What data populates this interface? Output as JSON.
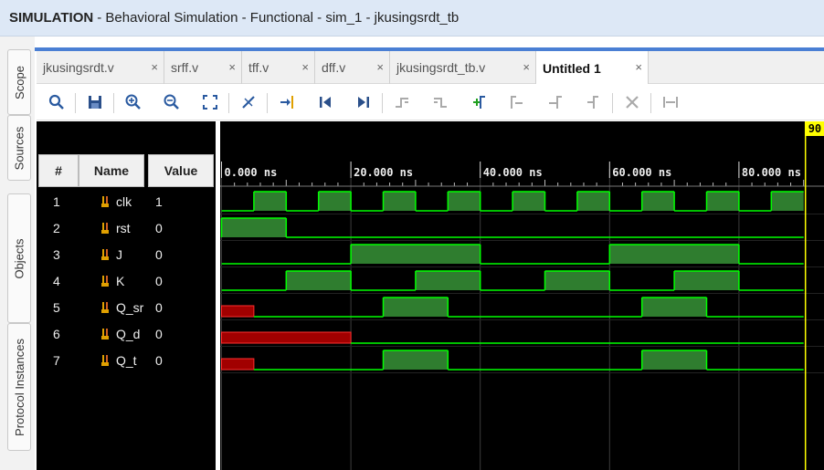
{
  "title": {
    "bold": "SIMULATION",
    "rest": "- Behavioral Simulation - Functional - sim_1 - jkusingsrdt_tb"
  },
  "side_tabs": [
    "Scope",
    "Sources",
    "Objects",
    "Protocol Instances"
  ],
  "tabs": [
    {
      "label": "jkusingsrdt.v",
      "close": "×"
    },
    {
      "label": "srff.v",
      "close": "×"
    },
    {
      "label": "tff.v",
      "close": "×"
    },
    {
      "label": "dff.v",
      "close": "×"
    },
    {
      "label": "jkusingsrdt_tb.v",
      "close": "×"
    },
    {
      "label": "Untitled 1",
      "close": "×"
    }
  ],
  "toolbar": [
    "search-icon",
    "save-icon",
    "zoom-in-icon",
    "zoom-out-icon",
    "zoom-fit-icon",
    "cursor-snap-icon",
    "go-to-cursor-icon",
    "go-to-start-icon",
    "go-to-end-icon",
    "previous-transition-icon",
    "next-transition-icon",
    "add-marker-icon",
    "previous-marker-icon",
    "next-marker-icon",
    "swap-cursors-icon",
    "delete-marker-icon",
    "marker-range-icon"
  ],
  "columns": {
    "num": "#",
    "name": "Name",
    "value": "Value"
  },
  "signals": [
    {
      "num": "1",
      "name": "clk",
      "value": "1"
    },
    {
      "num": "2",
      "name": "rst",
      "value": "0"
    },
    {
      "num": "3",
      "name": "J",
      "value": "0"
    },
    {
      "num": "4",
      "name": "K",
      "value": "0"
    },
    {
      "num": "5",
      "name": "Q_sr",
      "value": "0"
    },
    {
      "num": "6",
      "name": "Q_d",
      "value": "0"
    },
    {
      "num": "7",
      "name": "Q_t",
      "value": "0"
    }
  ],
  "timeline": {
    "ticks": [
      {
        "t": 0,
        "label": "0.000 ns"
      },
      {
        "t": 20,
        "label": "20.000 ns"
      },
      {
        "t": 40,
        "label": "40.000 ns"
      },
      {
        "t": 60,
        "label": "60.000 ns"
      },
      {
        "t": 80,
        "label": "80.000 ns"
      }
    ],
    "cursor_time": 90,
    "cursor_label": "90",
    "view_range_ns": [
      0,
      90
    ]
  },
  "waves": [
    {
      "name": "clk",
      "segments": [
        [
          0,
          5,
          0
        ],
        [
          5,
          10,
          1
        ],
        [
          10,
          15,
          0
        ],
        [
          15,
          20,
          1
        ],
        [
          20,
          25,
          0
        ],
        [
          25,
          30,
          1
        ],
        [
          30,
          35,
          0
        ],
        [
          35,
          40,
          1
        ],
        [
          40,
          45,
          0
        ],
        [
          45,
          50,
          1
        ],
        [
          50,
          55,
          0
        ],
        [
          55,
          60,
          1
        ],
        [
          60,
          65,
          0
        ],
        [
          65,
          70,
          1
        ],
        [
          70,
          75,
          0
        ],
        [
          75,
          80,
          1
        ],
        [
          80,
          85,
          0
        ],
        [
          85,
          90,
          1
        ]
      ]
    },
    {
      "name": "rst",
      "segments": [
        [
          0,
          10,
          1
        ],
        [
          10,
          90,
          0
        ]
      ]
    },
    {
      "name": "J",
      "segments": [
        [
          0,
          20,
          0
        ],
        [
          20,
          40,
          1
        ],
        [
          40,
          60,
          0
        ],
        [
          60,
          80,
          1
        ],
        [
          80,
          90,
          0
        ]
      ]
    },
    {
      "name": "K",
      "segments": [
        [
          0,
          10,
          0
        ],
        [
          10,
          20,
          1
        ],
        [
          20,
          30,
          0
        ],
        [
          30,
          40,
          1
        ],
        [
          40,
          50,
          0
        ],
        [
          50,
          60,
          1
        ],
        [
          60,
          70,
          0
        ],
        [
          70,
          80,
          1
        ],
        [
          80,
          90,
          0
        ]
      ]
    },
    {
      "name": "Q_sr",
      "segments": [
        [
          0,
          5,
          "x"
        ],
        [
          5,
          25,
          0
        ],
        [
          25,
          35,
          1
        ],
        [
          35,
          65,
          0
        ],
        [
          65,
          75,
          1
        ],
        [
          75,
          90,
          0
        ]
      ]
    },
    {
      "name": "Q_d",
      "segments": [
        [
          0,
          20,
          "x"
        ],
        [
          20,
          90,
          0
        ]
      ]
    },
    {
      "name": "Q_t",
      "segments": [
        [
          0,
          5,
          "x"
        ],
        [
          5,
          25,
          0
        ],
        [
          25,
          35,
          1
        ],
        [
          35,
          65,
          0
        ],
        [
          65,
          75,
          1
        ],
        [
          75,
          90,
          0
        ]
      ]
    }
  ],
  "colors": {
    "wave_high": "#2f7d2f",
    "wave_line": "#00ff00",
    "wave_x": "#a10000",
    "cursor": "#ffff00",
    "title_bg": "#dde8f6",
    "accent": "#4a7fd4"
  }
}
